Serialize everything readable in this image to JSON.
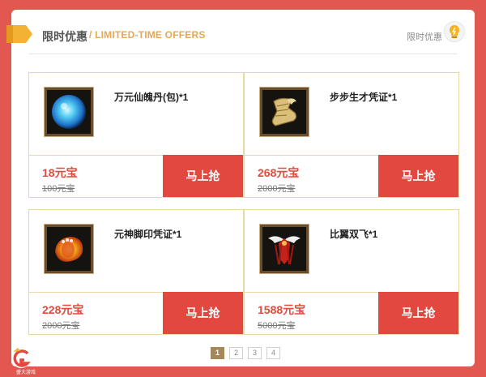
{
  "header": {
    "title": "限时优惠",
    "subtitle": "/ LIMITED-TIME OFFERS",
    "right_label": "限时优惠"
  },
  "offers": [
    {
      "name": "万元仙魄丹(包)*1",
      "price": "18元宝",
      "original_price": "100元宝",
      "button": "马上抢",
      "icon": "blue-orb-icon"
    },
    {
      "name": "步步生才凭证*1",
      "price": "268元宝",
      "original_price": "2000元宝",
      "button": "马上抢",
      "icon": "golden-boot-icon"
    },
    {
      "name": "元神脚印凭证*1",
      "price": "228元宝",
      "original_price": "2000元宝",
      "button": "马上抢",
      "icon": "fire-footprint-icon"
    },
    {
      "name": "比翼双飞*1",
      "price": "1588元宝",
      "original_price": "5000元宝",
      "button": "马上抢",
      "icon": "winged-crest-icon"
    }
  ],
  "pagination": {
    "pages": [
      "1",
      "2",
      "3",
      "4"
    ],
    "current": "1"
  },
  "footer": {
    "logo_text": "盛大游戏"
  },
  "colors": {
    "background": "#e2574f",
    "accent_red": "#e2483f",
    "price_red": "#e24a3f",
    "gold": "#e6a756",
    "active_page": "#a4885c"
  }
}
